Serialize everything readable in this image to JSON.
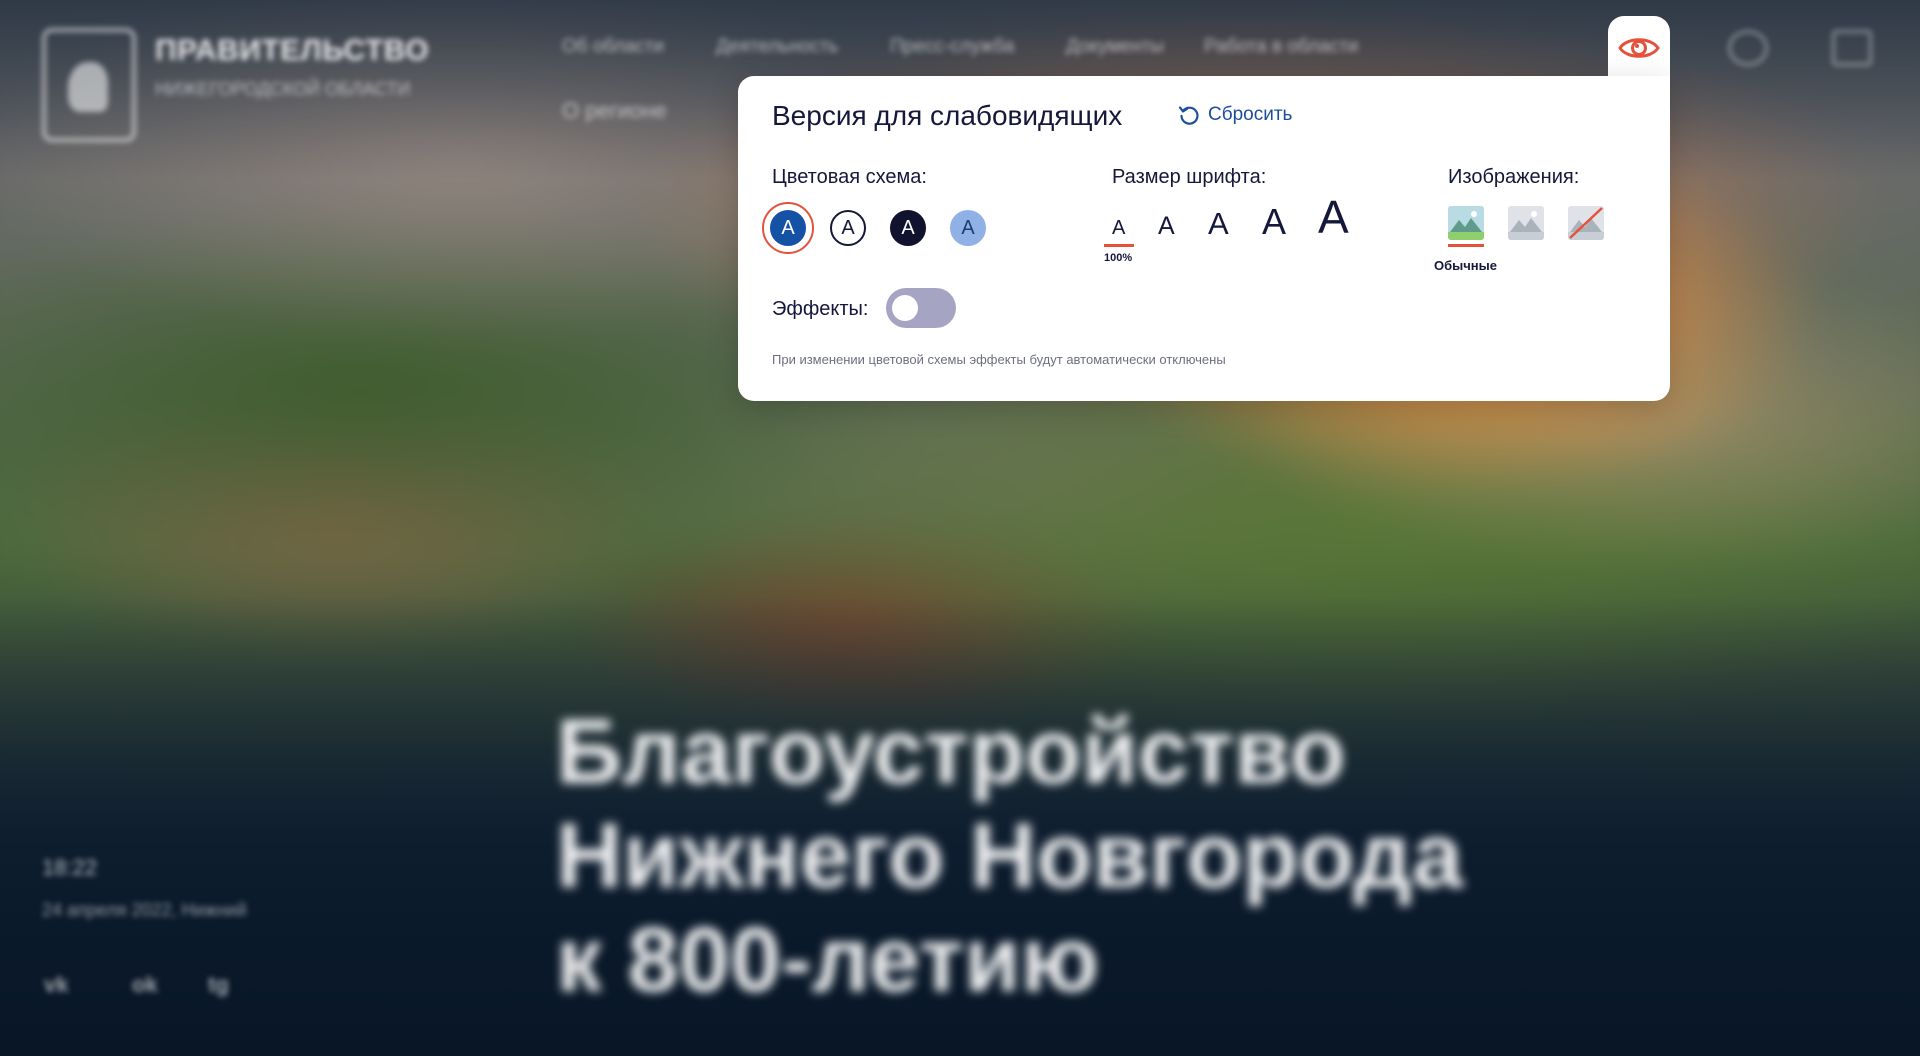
{
  "site": {
    "brand_title": "ПРАВИТЕЛЬСТВО",
    "brand_subtitle": "НИЖЕГОРОДСКОЙ ОБЛАСТИ",
    "nav": [
      "Об области",
      "Деятельность",
      "Пресс-служба",
      "Документы",
      "Работа в области"
    ],
    "region_label": "О регионе"
  },
  "hero": {
    "title_lines": [
      "Благоустройство",
      "Нижнего Новгорода",
      "к 800-летию"
    ],
    "time": "18:22",
    "date": "24 апреля 2022, Нижний",
    "socials": [
      "vk",
      "ok",
      "tg"
    ]
  },
  "accessibility_panel": {
    "title": "Версия для слабовидящих",
    "reset_label": "Сбросить",
    "color_scheme": {
      "label": "Цветовая схема:",
      "selected_index": 0,
      "options": [
        {
          "glyph": "A",
          "bg": "#1552a5",
          "fg": "#ffffff",
          "border": "#1552a5"
        },
        {
          "glyph": "A",
          "bg": "#ffffff",
          "fg": "#14183a",
          "border": "#14183a"
        },
        {
          "glyph": "A",
          "bg": "#10122e",
          "fg": "#ffffff",
          "border": "#10122e"
        },
        {
          "glyph": "A",
          "bg": "#8fb1e6",
          "fg": "#1c3d74",
          "border": "#8fb1e6"
        }
      ]
    },
    "font_size": {
      "label": "Размер шрифта:",
      "selected_caption": "100%",
      "options": [
        "A",
        "A",
        "A",
        "A",
        "A"
      ]
    },
    "images": {
      "label": "Изображения:",
      "selected_caption": "Обычные",
      "options": [
        "image-normal-icon",
        "image-grayscale-icon",
        "image-off-icon"
      ]
    },
    "effects": {
      "label": "Эффекты:",
      "enabled": false
    },
    "hint": "При изменении цветовой схемы эффекты будут автоматически отключены"
  },
  "colors": {
    "accent": "#e4523b",
    "link": "#1d4e9b",
    "text": "#14183a",
    "toggle_off": "#a5a5c3"
  }
}
